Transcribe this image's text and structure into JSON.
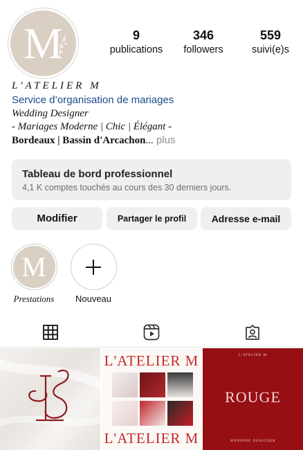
{
  "profile": {
    "avatar_letter": "M",
    "stats": [
      {
        "value": "9",
        "label": "publications"
      },
      {
        "value": "346",
        "label": "followers"
      },
      {
        "value": "559",
        "label": "suivi(e)s"
      }
    ],
    "name": "L'ATELIER M",
    "category": "Service d’organisation de mariages",
    "bio_line1": "Wedding Designer",
    "bio_line2": "- Mariages Moderne | Chic | Élégant -",
    "bio_location": "Bordeaux | Bassin d'Arcachon",
    "bio_ellipsis": "...",
    "bio_more": " plus"
  },
  "dashboard": {
    "title": "Tableau de bord professionnel",
    "subtitle": "4,1 K comptes touchés au cours des 30 derniers jours."
  },
  "actions": {
    "edit": "Modifier",
    "share": "Partager le profil",
    "email": "Adresse e-mail"
  },
  "highlights": [
    {
      "label": "Prestations",
      "letter": "M"
    },
    {
      "label": "Nouveau"
    }
  ],
  "tabs": [
    {
      "icon": "grid-icon",
      "active": true
    },
    {
      "icon": "reels-icon",
      "active": false
    },
    {
      "icon": "tagged-icon",
      "active": false
    }
  ],
  "posts": [
    {
      "type": "monogram",
      "initials": "LS"
    },
    {
      "type": "collage",
      "title_top": "L'ATELIER M",
      "title_bottom": "L'ATELIER M"
    },
    {
      "type": "text",
      "small_top": "L'ATELIER M",
      "headline": "ROUGE",
      "small_bottom": "WEDDING DESIGNER"
    }
  ],
  "colors": {
    "link": "#1a4a8b",
    "button_bg": "#efefef",
    "beige": "#d9cfc2",
    "wine_red": "#950f13",
    "monogram_red": "#8c1a1f"
  }
}
